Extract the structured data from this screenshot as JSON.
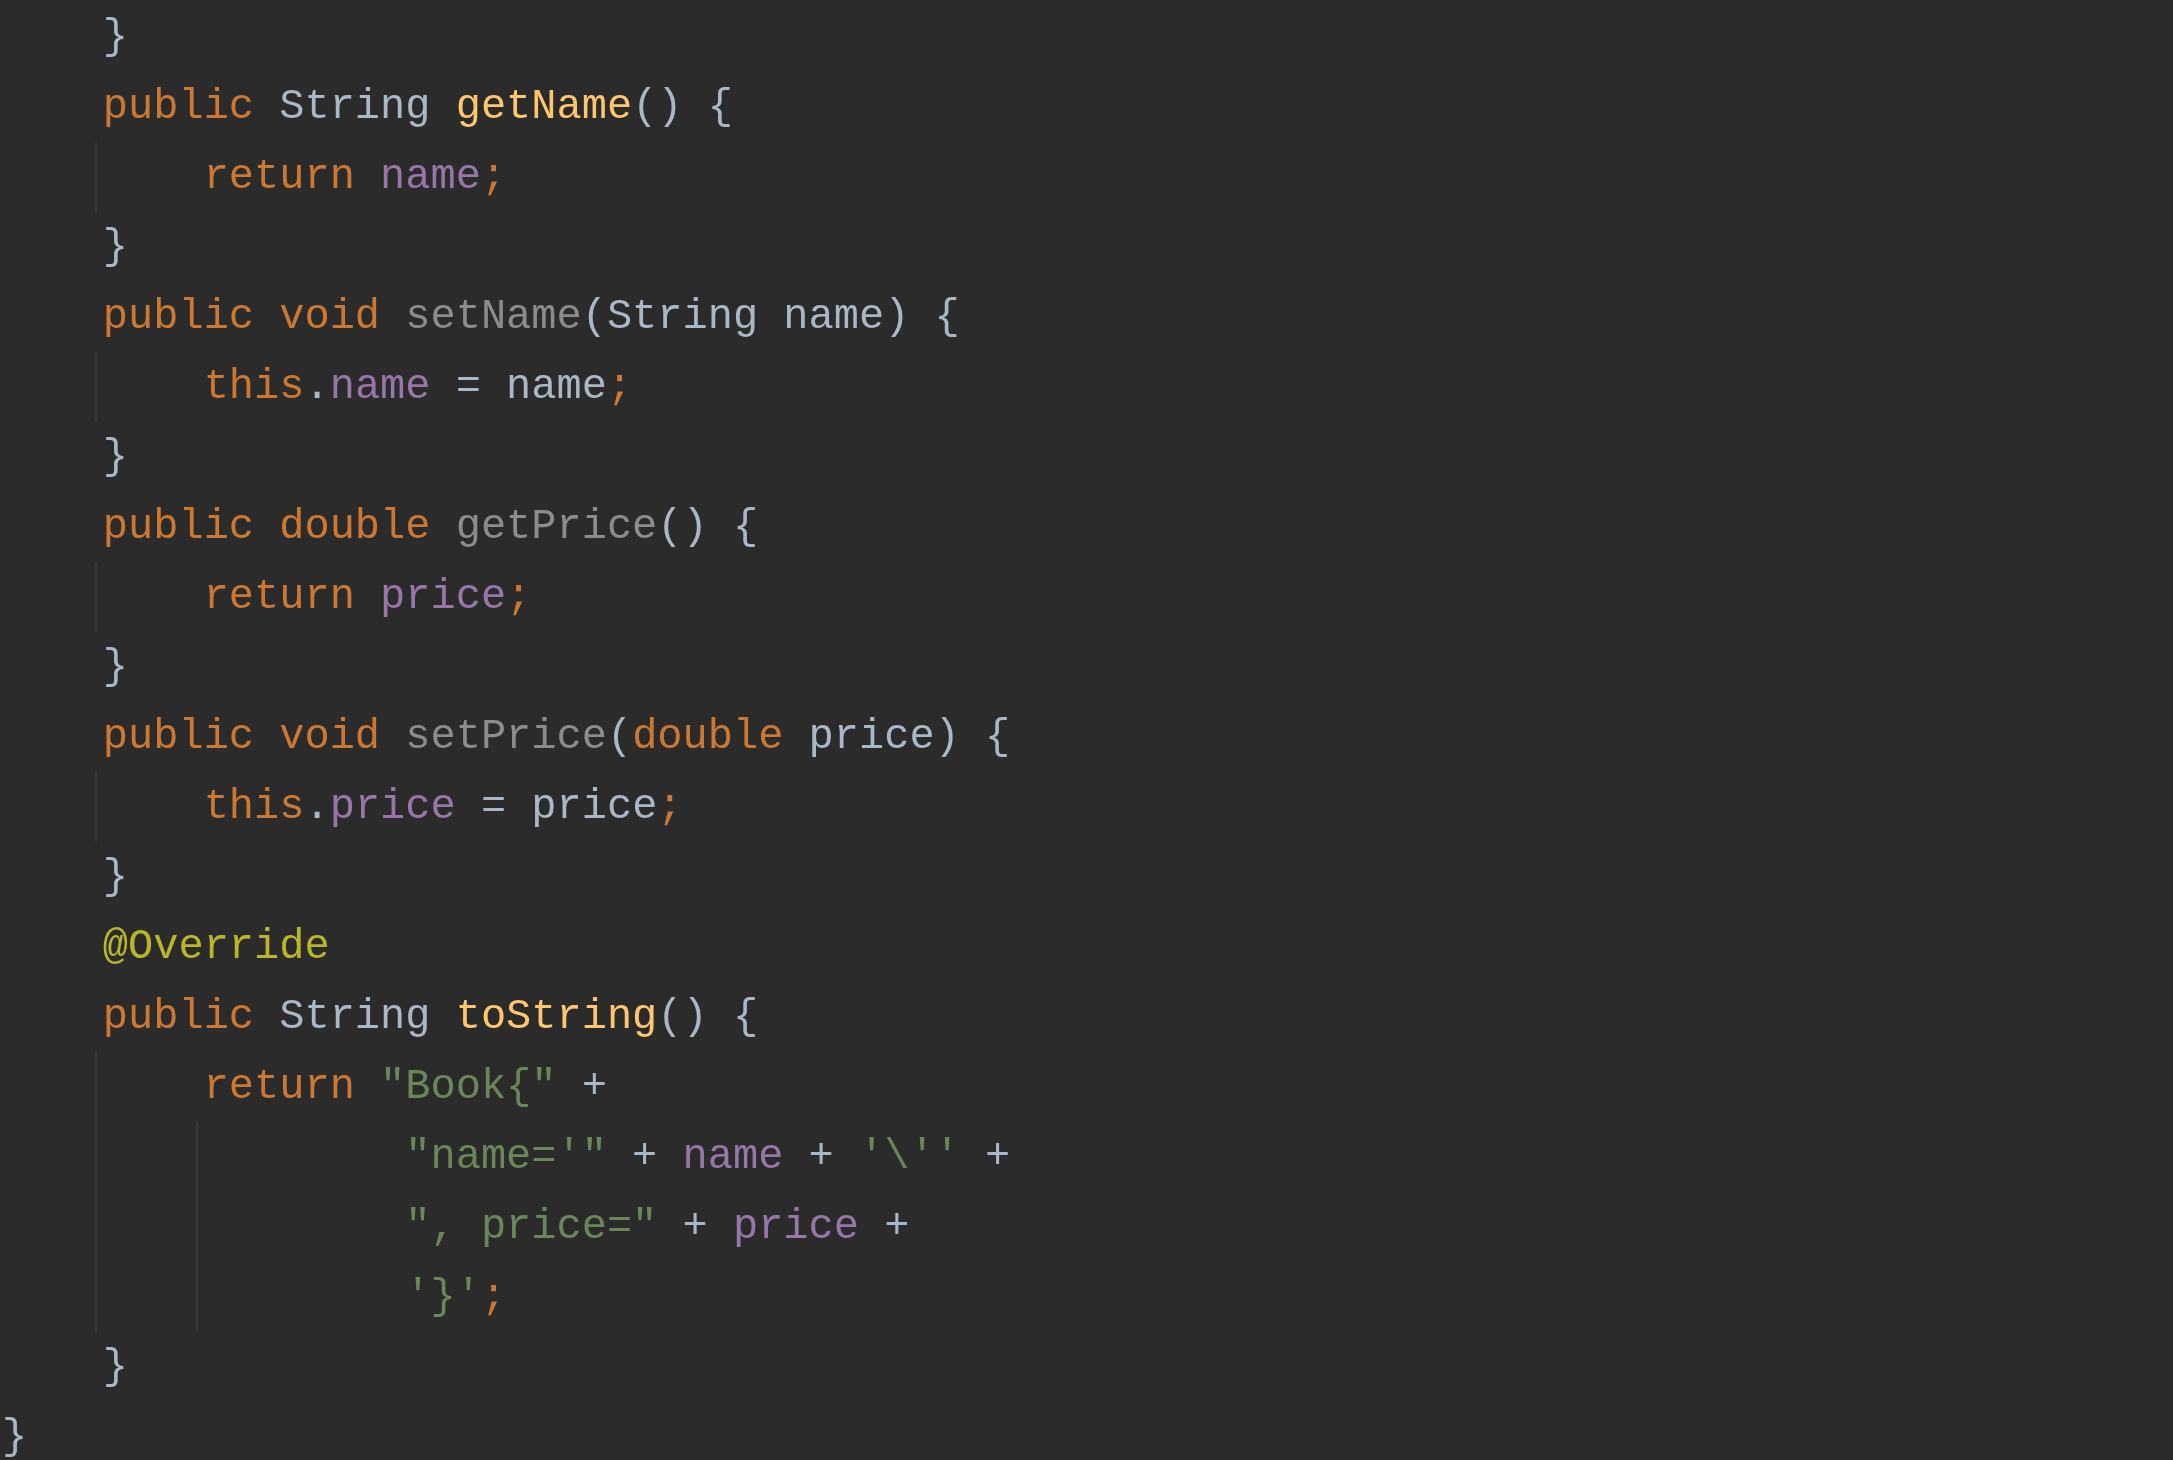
{
  "editor": {
    "lines": [
      {
        "tokens": [
          {
            "kind": "plain",
            "text": "    }"
          }
        ]
      },
      {
        "tokens": [
          {
            "kind": "kw",
            "text": "    public "
          },
          {
            "kind": "plain",
            "text": "String "
          },
          {
            "kind": "decl",
            "text": "getName"
          },
          {
            "kind": "plain",
            "text": "() {"
          }
        ]
      },
      {
        "tokens": [
          {
            "kind": "kw",
            "text": "        return "
          },
          {
            "kind": "field",
            "text": "name"
          },
          {
            "kind": "semi",
            "text": ";"
          }
        ]
      },
      {
        "tokens": [
          {
            "kind": "plain",
            "text": "    }"
          }
        ]
      },
      {
        "tokens": [
          {
            "kind": "kw",
            "text": "    public void "
          },
          {
            "kind": "unused",
            "text": "setName"
          },
          {
            "kind": "plain",
            "text": "(String name) {"
          }
        ]
      },
      {
        "tokens": [
          {
            "kind": "kw",
            "text": "        this"
          },
          {
            "kind": "plain",
            "text": "."
          },
          {
            "kind": "field",
            "text": "name"
          },
          {
            "kind": "plain",
            "text": " = name"
          },
          {
            "kind": "semi",
            "text": ";"
          }
        ]
      },
      {
        "tokens": [
          {
            "kind": "plain",
            "text": "    }"
          }
        ]
      },
      {
        "tokens": [
          {
            "kind": "kw",
            "text": "    public double "
          },
          {
            "kind": "unused",
            "text": "getPrice"
          },
          {
            "kind": "plain",
            "text": "() {"
          }
        ]
      },
      {
        "tokens": [
          {
            "kind": "kw",
            "text": "        return "
          },
          {
            "kind": "field",
            "text": "price"
          },
          {
            "kind": "semi",
            "text": ";"
          }
        ]
      },
      {
        "tokens": [
          {
            "kind": "plain",
            "text": "    }"
          }
        ]
      },
      {
        "tokens": [
          {
            "kind": "kw",
            "text": "    public void "
          },
          {
            "kind": "unused",
            "text": "setPrice"
          },
          {
            "kind": "plain",
            "text": "("
          },
          {
            "kind": "kw",
            "text": "double "
          },
          {
            "kind": "plain",
            "text": "price) {"
          }
        ]
      },
      {
        "tokens": [
          {
            "kind": "kw",
            "text": "        this"
          },
          {
            "kind": "plain",
            "text": "."
          },
          {
            "kind": "field",
            "text": "price"
          },
          {
            "kind": "plain",
            "text": " = price"
          },
          {
            "kind": "semi",
            "text": ";"
          }
        ]
      },
      {
        "tokens": [
          {
            "kind": "plain",
            "text": "    }"
          }
        ]
      },
      {
        "tokens": [
          {
            "kind": "ann",
            "text": "    @Override"
          }
        ]
      },
      {
        "tokens": [
          {
            "kind": "kw",
            "text": "    public "
          },
          {
            "kind": "plain",
            "text": "String "
          },
          {
            "kind": "decl",
            "text": "toString"
          },
          {
            "kind": "plain",
            "text": "() {"
          }
        ]
      },
      {
        "tokens": [
          {
            "kind": "kw",
            "text": "        return "
          },
          {
            "kind": "str",
            "text": "\"Book{\""
          },
          {
            "kind": "plain",
            "text": " +"
          }
        ]
      },
      {
        "tokens": [
          {
            "kind": "str",
            "text": "                \"name='\""
          },
          {
            "kind": "plain",
            "text": " + "
          },
          {
            "kind": "field",
            "text": "name"
          },
          {
            "kind": "plain",
            "text": " + "
          },
          {
            "kind": "str",
            "text": "'\\''"
          },
          {
            "kind": "plain",
            "text": " +"
          }
        ]
      },
      {
        "tokens": [
          {
            "kind": "str",
            "text": "                \", price=\""
          },
          {
            "kind": "plain",
            "text": " + "
          },
          {
            "kind": "field",
            "text": "price"
          },
          {
            "kind": "plain",
            "text": " +"
          }
        ]
      },
      {
        "tokens": [
          {
            "kind": "str",
            "text": "                '}'"
          },
          {
            "kind": "semi",
            "text": ";"
          }
        ]
      },
      {
        "tokens": [
          {
            "kind": "plain",
            "text": "    }"
          }
        ]
      },
      {
        "tokens": [
          {
            "kind": "plain",
            "text": "}"
          }
        ]
      }
    ]
  }
}
